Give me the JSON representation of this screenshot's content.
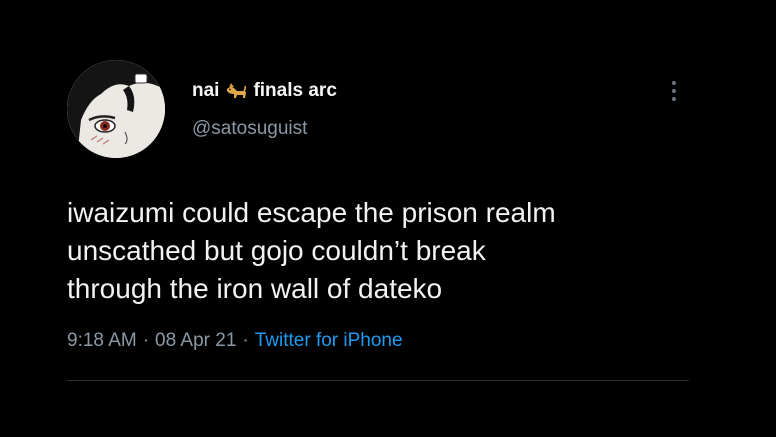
{
  "tweet": {
    "author": {
      "display_name_part1": "nai",
      "display_name_emoji": "dog-emoji",
      "display_name_part2": "finals arc",
      "handle": "@satosuguist",
      "avatar_icon": "avatar-anime-girl"
    },
    "text_lines": [
      "iwaizumi could escape the prison realm",
      "unscathed but gojo couldn’t break",
      "through the iron wall of dateko"
    ],
    "time": "9:18 AM",
    "separator": "·",
    "date": "08 Apr 21",
    "source": "Twitter for iPhone",
    "more_icon": "more-vertical-icon"
  },
  "colors": {
    "background": "#000000",
    "text_primary": "#f2f2f2",
    "text_secondary": "#8b98a5",
    "link": "#1d9bf0"
  }
}
